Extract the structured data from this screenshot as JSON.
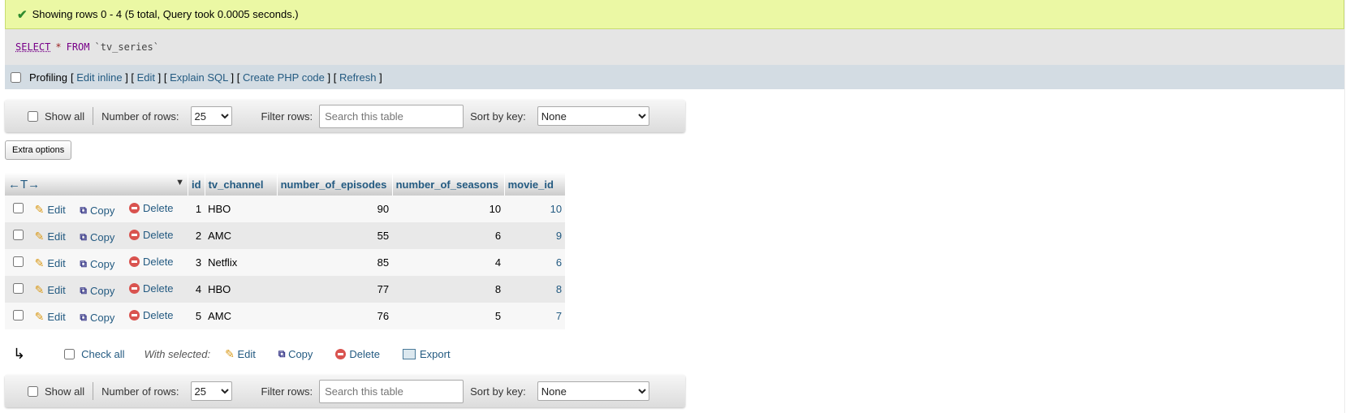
{
  "status": {
    "message": "Showing rows 0 - 4 (5 total, Query took 0.0005 seconds.)"
  },
  "sql": {
    "select": "SELECT",
    "star": "*",
    "from": "FROM",
    "table": "`tv_series`"
  },
  "profiling": {
    "label": "Profiling",
    "links": [
      "Edit inline",
      "Edit",
      "Explain SQL",
      "Create PHP code",
      "Refresh"
    ]
  },
  "toolbar": {
    "show_all": "Show all",
    "number_of_rows_label": "Number of rows:",
    "number_of_rows_value": "25",
    "filter_label": "Filter rows:",
    "filter_placeholder": "Search this table",
    "sort_label": "Sort by key:",
    "sort_value": "None"
  },
  "extra_options": "Extra options",
  "table": {
    "nav_arrows": "←T→",
    "columns": [
      "id",
      "tv_channel",
      "number_of_episodes",
      "number_of_seasons",
      "movie_id"
    ],
    "actions": {
      "edit": "Edit",
      "copy": "Copy",
      "delete": "Delete"
    },
    "rows": [
      {
        "id": "1",
        "tv_channel": "HBO",
        "number_of_episodes": "90",
        "number_of_seasons": "10",
        "movie_id": "10"
      },
      {
        "id": "2",
        "tv_channel": "AMC",
        "number_of_episodes": "55",
        "number_of_seasons": "6",
        "movie_id": "9"
      },
      {
        "id": "3",
        "tv_channel": "Netflix",
        "number_of_episodes": "85",
        "number_of_seasons": "4",
        "movie_id": "6"
      },
      {
        "id": "4",
        "tv_channel": "HBO",
        "number_of_episodes": "77",
        "number_of_seasons": "8",
        "movie_id": "8"
      },
      {
        "id": "5",
        "tv_channel": "AMC",
        "number_of_episodes": "76",
        "number_of_seasons": "5",
        "movie_id": "7"
      }
    ]
  },
  "bulk": {
    "check_all": "Check all",
    "with_selected": "With selected:",
    "edit": "Edit",
    "copy": "Copy",
    "delete": "Delete",
    "export": "Export"
  }
}
